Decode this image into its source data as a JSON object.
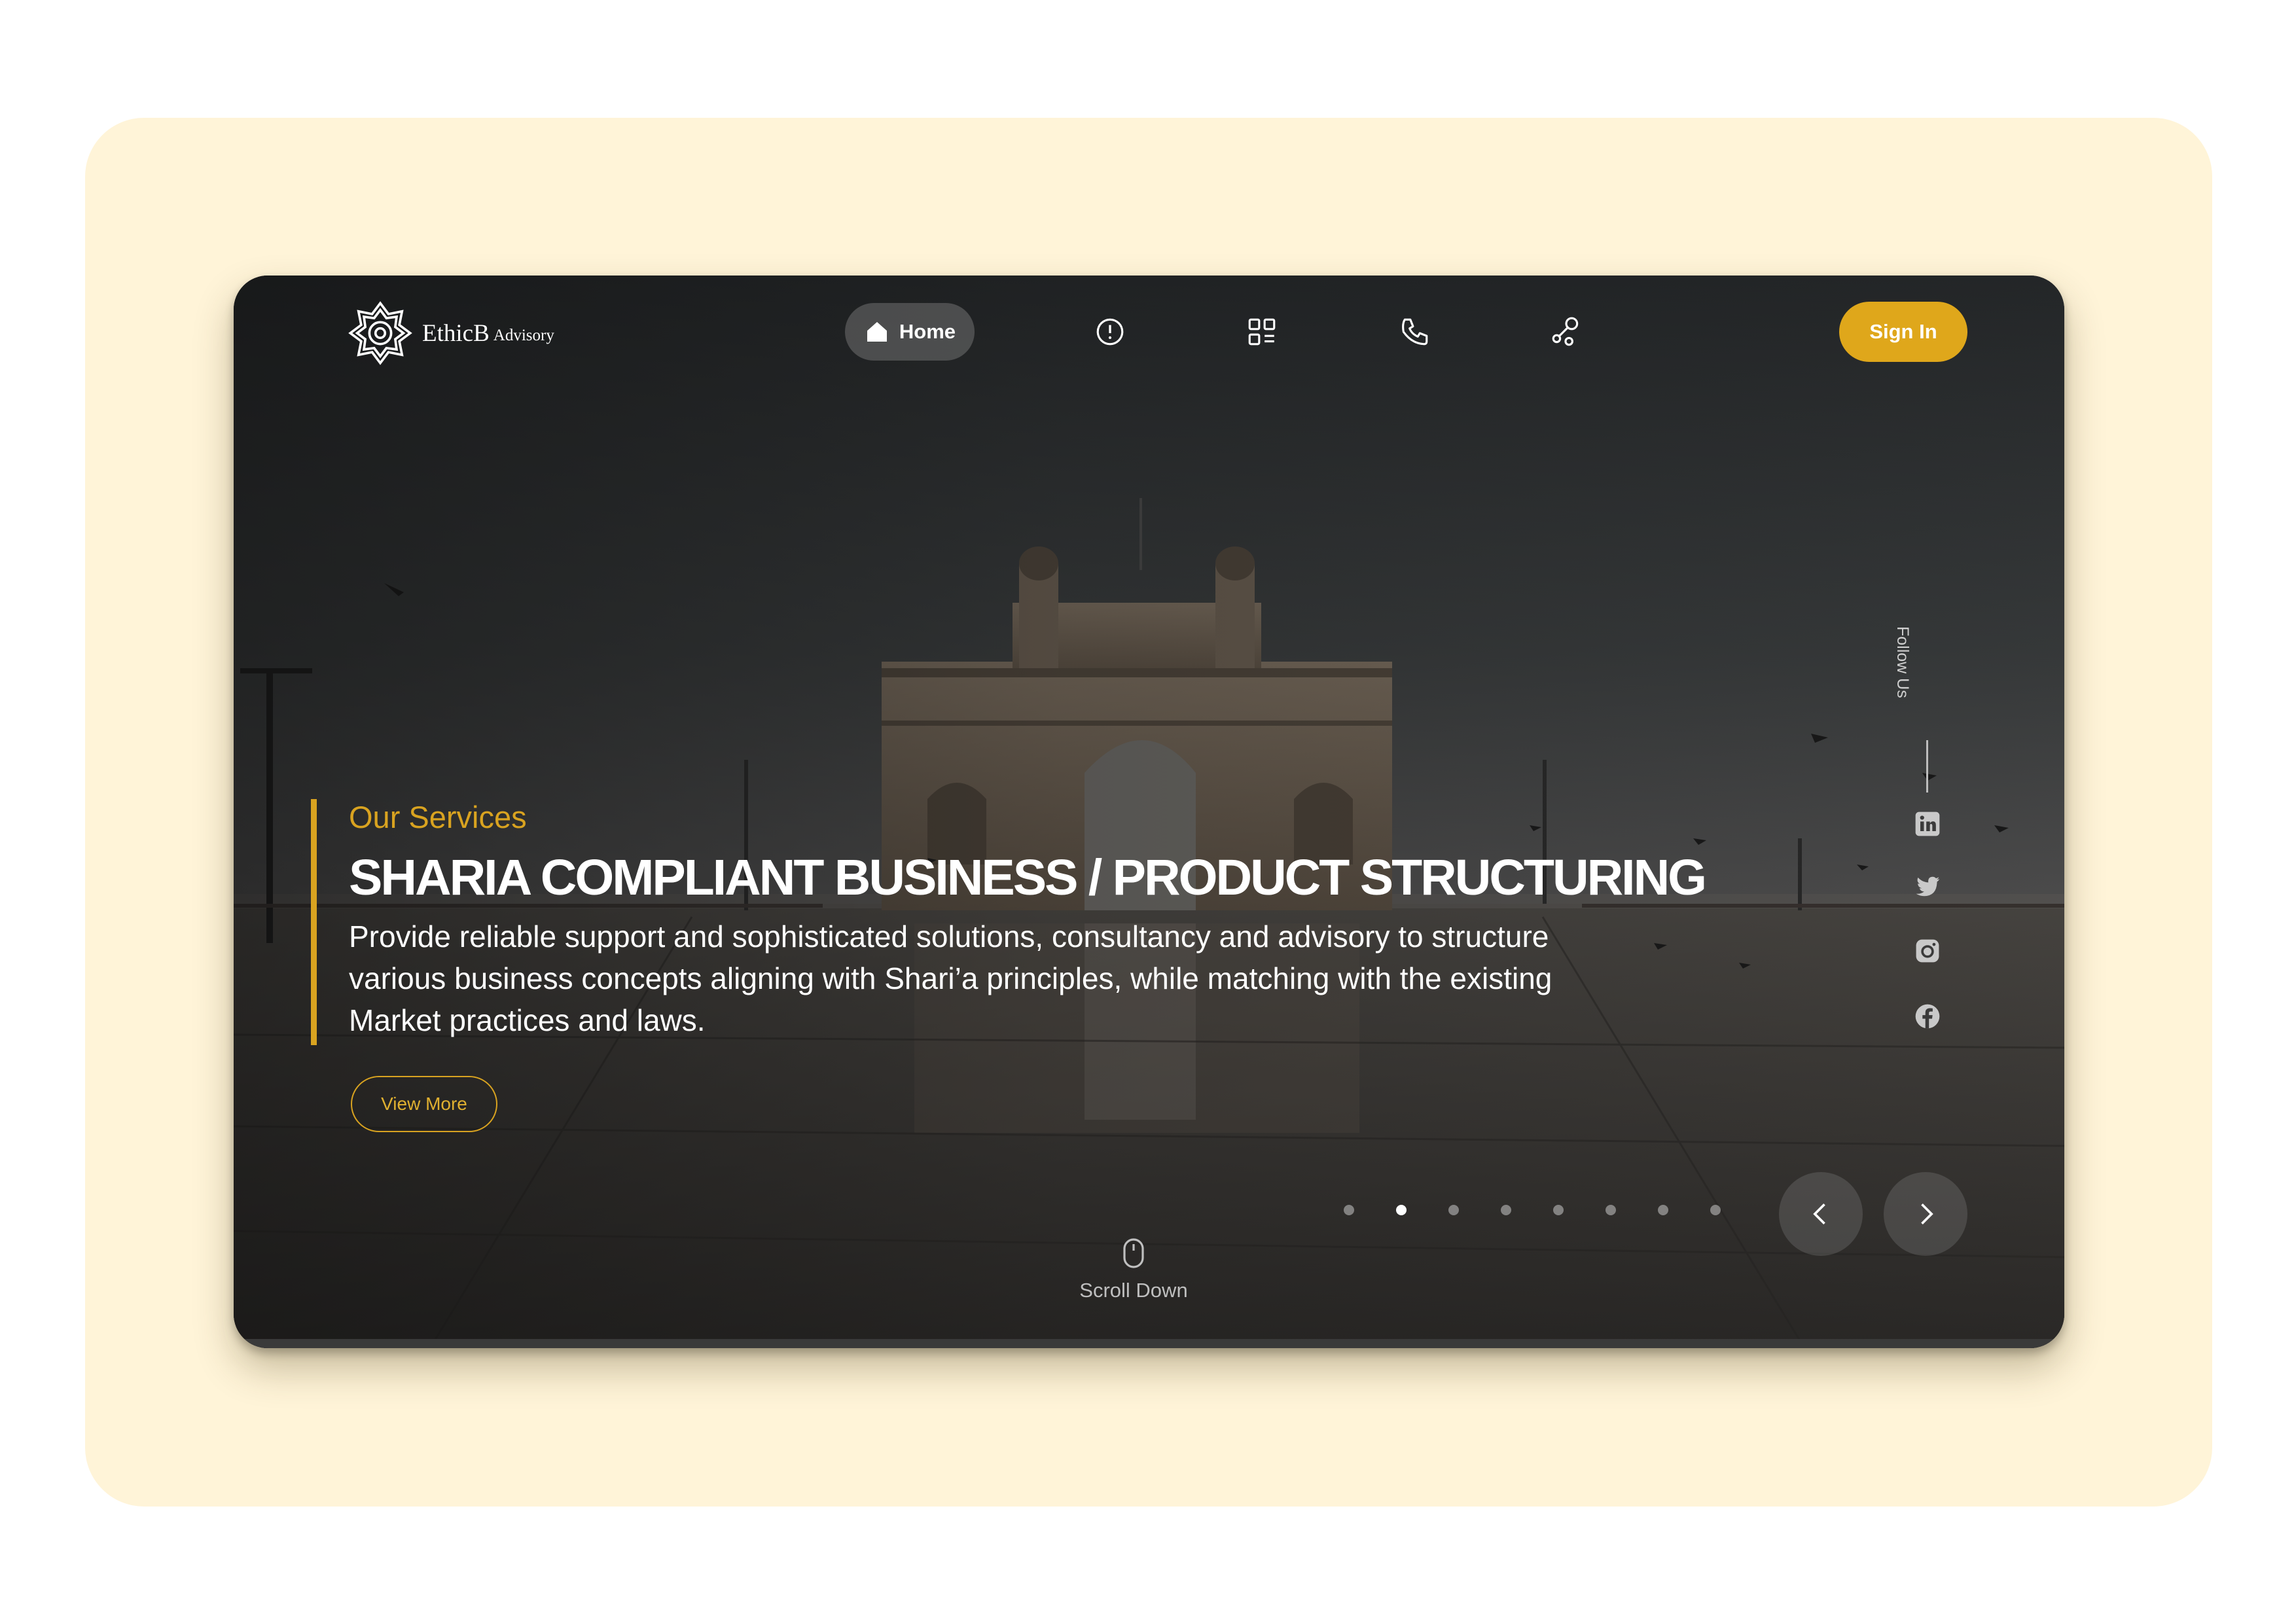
{
  "brand": {
    "name": "EthicB",
    "suffix": "Advisory"
  },
  "nav": {
    "home_label": "Home",
    "items": [
      {
        "icon": "home-icon",
        "label": "Home",
        "active": true
      },
      {
        "icon": "info-icon"
      },
      {
        "icon": "services-grid-icon"
      },
      {
        "icon": "phone-icon"
      },
      {
        "icon": "network-icon"
      }
    ]
  },
  "header": {
    "signin_label": "Sign In"
  },
  "hero": {
    "eyebrow": "Our Services",
    "headline": "SHARIA COMPLIANT BUSINESS / PRODUCT STRUCTURING",
    "description": "Provide reliable support and sophisticated solutions, consultancy and advisory to structure various business concepts aligning with Shari’a principles, while matching with the existing Market practices and laws.",
    "cta_label": "View More"
  },
  "social": {
    "follow_label": "Follow Us",
    "links": [
      "linkedin-icon",
      "twitter-icon",
      "instagram-icon",
      "facebook-icon"
    ]
  },
  "slider": {
    "total": 8,
    "active_index": 1
  },
  "scroll": {
    "label": "Scroll Down"
  },
  "colors": {
    "accent": "#dfa71b",
    "backdrop": "#fff4d8",
    "text": "#ffffff"
  }
}
